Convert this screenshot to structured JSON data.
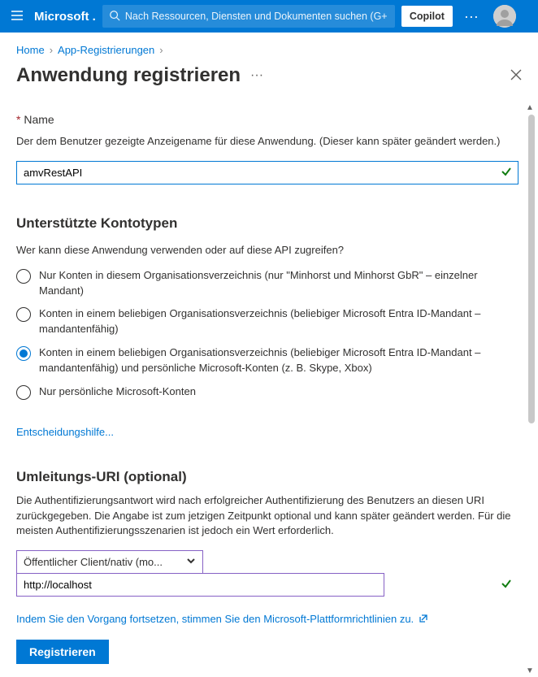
{
  "header": {
    "brand": "Microsoft .",
    "search_placeholder": "Nach Ressourcen, Diensten und Dokumenten suchen (G+",
    "copilot_label": "Copilot"
  },
  "breadcrumb": {
    "home": "Home",
    "appreg": "App-Registrierungen"
  },
  "title": "Anwendung registrieren",
  "name": {
    "label": "Name",
    "help": "Der dem Benutzer gezeigte Anzeigename für diese Anwendung. (Dieser kann später geändert werden.)",
    "value": "amvRestAPI"
  },
  "accounts": {
    "heading": "Unterstützte Kontotypen",
    "help": "Wer kann diese Anwendung verwenden oder auf diese API zugreifen?",
    "options": [
      "Nur Konten in diesem Organisationsverzeichnis (nur \"Minhorst und Minhorst GbR\" – einzelner Mandant)",
      "Konten in einem beliebigen Organisationsverzeichnis (beliebiger Microsoft Entra ID-Mandant – mandantenfähig)",
      "Konten in einem beliebigen Organisationsverzeichnis (beliebiger Microsoft Entra ID-Mandant – mandantenfähig) und persönliche Microsoft-Konten (z. B. Skype, Xbox)",
      "Nur persönliche Microsoft-Konten"
    ],
    "selected_index": 2,
    "decision_link": "Entscheidungshilfe..."
  },
  "redirect": {
    "heading": "Umleitungs-URI (optional)",
    "help": "Die Authentifizierungsantwort wird nach erfolgreicher Authentifizierung des Benutzers an diesen URI zurückgegeben. Die Angabe ist zum jetzigen Zeitpunkt optional und kann später geändert werden. Für die meisten Authentifizierungsszenarien ist jedoch ein Wert erforderlich.",
    "platform_value": "Öffentlicher Client/nativ (mo...",
    "uri_value": "http://localhost"
  },
  "consent": "Indem Sie den Vorgang fortsetzen, stimmen Sie den Microsoft-Plattformrichtlinien zu.",
  "register_label": "Registrieren"
}
